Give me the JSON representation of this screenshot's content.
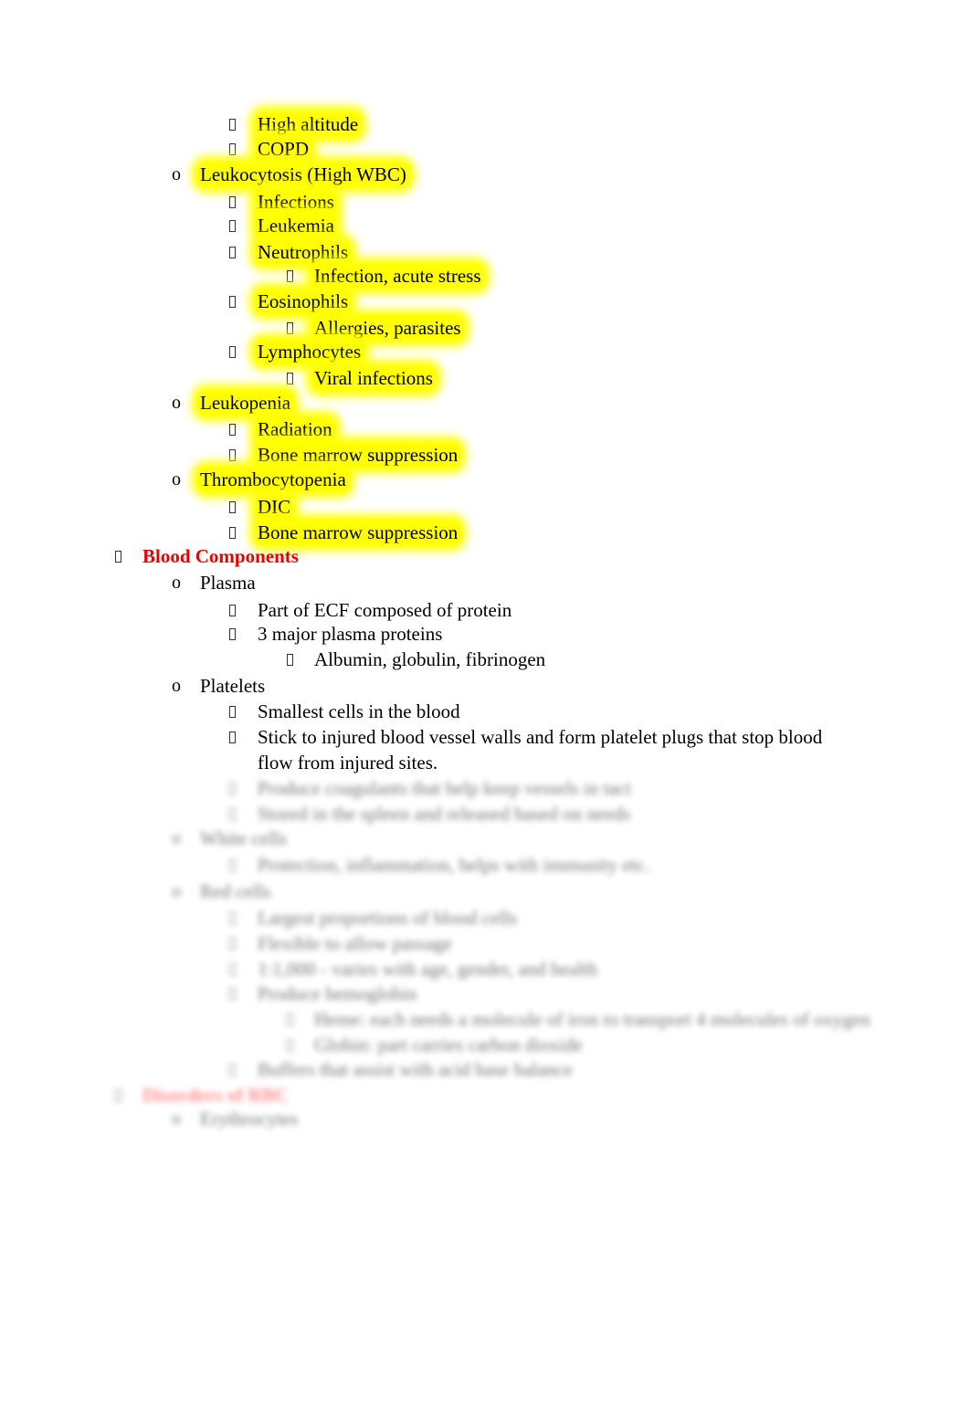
{
  "document": {
    "highlight_color": "#ffff00",
    "heading_color": "#ee0000",
    "rows": [
      {
        "level": 3,
        "bullet": "square",
        "text": "High altitude",
        "highlight": true
      },
      {
        "level": 3,
        "bullet": "square",
        "text": "COPD",
        "highlight": true
      },
      {
        "level": 2,
        "bullet": "o",
        "text": "Leukocytosis (High WBC)",
        "highlight": true
      },
      {
        "level": 3,
        "bullet": "square",
        "text": "Infections",
        "highlight": true
      },
      {
        "level": 3,
        "bullet": "square",
        "text": "Leukemia",
        "highlight": true
      },
      {
        "level": 3,
        "bullet": "square",
        "text": "Neutrophils",
        "highlight": true
      },
      {
        "level": 4,
        "bullet": "square",
        "text": "Infection, acute stress",
        "highlight": true
      },
      {
        "level": 3,
        "bullet": "square",
        "text": "Eosinophils",
        "highlight": true
      },
      {
        "level": 4,
        "bullet": "square",
        "text": "Allergies, parasites",
        "highlight": true
      },
      {
        "level": 3,
        "bullet": "square",
        "text": "Lymphocytes",
        "highlight": true
      },
      {
        "level": 4,
        "bullet": "square",
        "text": "Viral infections",
        "highlight": true
      },
      {
        "level": 2,
        "bullet": "o",
        "text": "Leukopenia",
        "highlight": true
      },
      {
        "level": 3,
        "bullet": "square",
        "text": "Radiation",
        "highlight": true
      },
      {
        "level": 3,
        "bullet": "square",
        "text": "Bone marrow suppression",
        "highlight": true
      },
      {
        "level": 2,
        "bullet": "o",
        "text": "Thrombocytopenia",
        "highlight": true
      },
      {
        "level": 3,
        "bullet": "square",
        "text": "DIC",
        "highlight": true
      },
      {
        "level": 3,
        "bullet": "square",
        "text": "Bone marrow suppression",
        "highlight": true
      },
      {
        "level": 1,
        "bullet": "square",
        "text": "Blood Components",
        "heading": true
      },
      {
        "level": 2,
        "bullet": "o",
        "text": "Plasma"
      },
      {
        "level": 3,
        "bullet": "square",
        "text": "Part of ECF composed of protein"
      },
      {
        "level": 3,
        "bullet": "square",
        "text": "3 major plasma proteins"
      },
      {
        "level": 4,
        "bullet": "square",
        "text": "Albumin, globulin, fibrinogen"
      },
      {
        "level": 2,
        "bullet": "o",
        "text": "Platelets"
      },
      {
        "level": 3,
        "bullet": "square",
        "text": "Smallest cells in the blood"
      },
      {
        "level": 3,
        "bullet": "square",
        "text": "Stick to injured blood vessel walls and form platelet plugs that stop blood"
      },
      {
        "level": 3,
        "bullet": "none",
        "text": "flow from injured sites."
      },
      {
        "level": 3,
        "bullet": "square",
        "text": "Produce coagulants that help keep vessels in tact",
        "blurred": true
      },
      {
        "level": 3,
        "bullet": "square",
        "text": "Stored in the spleen and released based on needs",
        "blurred": true
      },
      {
        "level": 2,
        "bullet": "o",
        "text": "White cells",
        "blurred": true
      },
      {
        "level": 3,
        "bullet": "square",
        "text": "Protection, inflammation, helps with immunity etc.",
        "blurred": true
      },
      {
        "level": 2,
        "bullet": "o",
        "text": "Red cells",
        "blurred": true
      },
      {
        "level": 3,
        "bullet": "square",
        "text": "Largest proportions of blood cells",
        "blurred": true
      },
      {
        "level": 3,
        "bullet": "square",
        "text": "Flexible to allow passage",
        "blurred": true
      },
      {
        "level": 3,
        "bullet": "square",
        "text": "1:1,000 - varies with age, gender, and health",
        "blurred": true
      },
      {
        "level": 3,
        "bullet": "square",
        "text": "Produce hemoglobin",
        "blurred": true
      },
      {
        "level": 4,
        "bullet": "square",
        "text": "Heme: each needs a molecule of iron to transport 4 molecules of oxygen",
        "blurred": true
      },
      {
        "level": 4,
        "bullet": "square",
        "text": "Globin: part carries carbon dioxide",
        "blurred": true
      },
      {
        "level": 3,
        "bullet": "square",
        "text": "Buffers that assist with acid base balance",
        "blurred": true
      },
      {
        "level": 1,
        "bullet": "square",
        "text": "Disorders of RBC",
        "heading": true,
        "blurred": true
      },
      {
        "level": 2,
        "bullet": "o",
        "text": "Erythrocytes",
        "blurred": true
      }
    ]
  }
}
